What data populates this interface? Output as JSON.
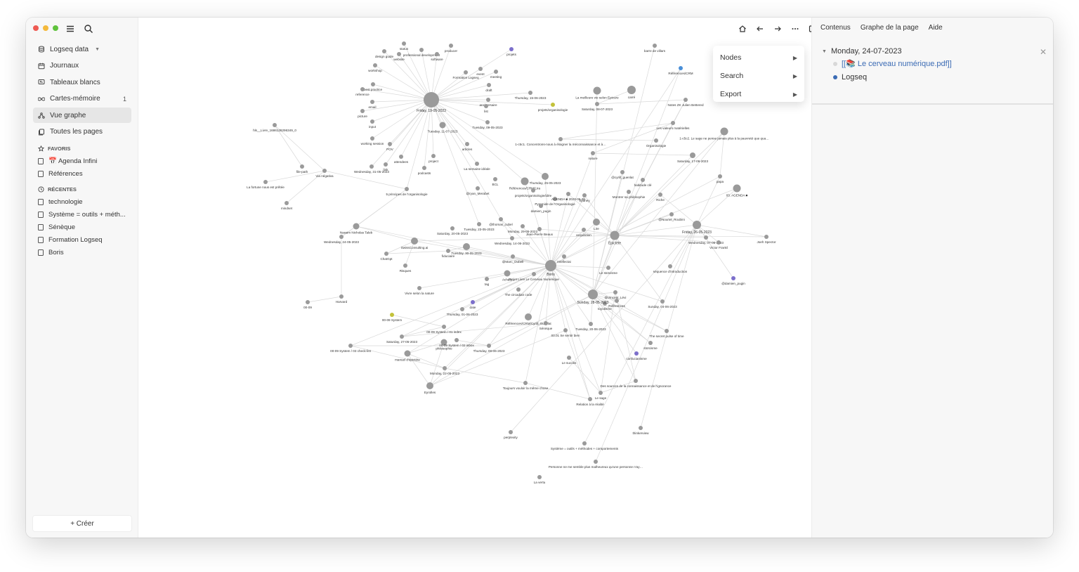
{
  "sidebar": {
    "graph_name": "Logseq data",
    "nav": [
      {
        "label": "Journaux",
        "icon": "calendar-icon"
      },
      {
        "label": "Tableaux blancs",
        "icon": "whiteboard-icon"
      },
      {
        "label": "Cartes-mémoire",
        "icon": "infinity-icon",
        "count": "1"
      },
      {
        "label": "Vue graphe",
        "icon": "graph-icon",
        "active": true
      },
      {
        "label": "Toutes les pages",
        "icon": "pages-icon"
      }
    ],
    "favorites_label": "FAVORIS",
    "favorites": [
      "📅 Agenda Infini",
      "Références"
    ],
    "recents_label": "RÉCENTES",
    "recents": [
      "technologie",
      "Système = outils + méth...",
      "Sénèque",
      "Formation Logseq",
      "Boris"
    ],
    "create_label": "+ Créer"
  },
  "context_menu": {
    "items": [
      {
        "label": "Nodes"
      },
      {
        "label": "Search"
      },
      {
        "label": "Export"
      }
    ]
  },
  "right_panel": {
    "tabs": [
      "Contenus",
      "Graphe de la page",
      "Aide"
    ],
    "page_title": "Monday, 24-07-2023",
    "blocks": [
      "[[📚 Le cerveau numérique.pdf]]",
      "Logseq"
    ]
  },
  "colors": {
    "node": "#9a9a9a",
    "edge": "#d9d9d9",
    "accent_purple": "#7c6fcb",
    "accent_yellow": "#c3c23a",
    "accent_blue": "#4a8fd8"
  },
  "graph": {
    "hubs": [
      {
        "label": "Friday, 19-05-2023"
      },
      {
        "label": "Boris"
      },
      {
        "label": "Sunday, 28-05-2023"
      },
      {
        "label": "Épictète"
      },
      {
        "label": "Friday, 26-05-2023"
      }
    ],
    "labels": [
      "status",
      "professional development",
      "design guide",
      "website",
      "software",
      "producer",
      "projets",
      "workshop",
      "Formation Logseq",
      "event",
      "meeting",
      "best practice",
      "reference",
      "draft",
      "email",
      "anniversaire",
      "list",
      "Thursday, 15-06-2023",
      "projets/organisologie",
      "picture",
      "input",
      "Tuesday, 11-07-2023",
      "Tuesday, 09-05-2023",
      "working session",
      "POV",
      "articles",
      "attendees",
      "project",
      "link",
      "Wednesday, 31-05-2023",
      "podcasts",
      "La semaine idéale",
      "hls__Livre_1686128296349_0",
      "file-path",
      "Via négativa",
      "La fortune nous est prêtée",
      "mindset",
      "5 principes de l'organisologie",
      "BCL",
      "@ryan_Merabet",
      "Références/CRM/Lira",
      "Thursday, 25-05-2023",
      "projets/organisologie/idée",
      "Pyramide de l'Organisologie",
      "AGENDA ■ 2023-06-20",
      "Sydney",
      "damien_pugin",
      "Nassim Nicholas Taleb",
      "Wednesday, 24-05-2023",
      "@thomas_cubel",
      "Monday, 29-05-2023",
      "Saturday, 20-05-2023",
      "Tuesday, 23-05-2023",
      "Jean-Pierre Beaux",
      "acquisition",
      "Lire",
      "SwissConsulting.ai",
      "Wednesday, 14-06-2023",
      "ChatGpt",
      "Tuesday, 30-05-2023",
      "fiduciaire",
      "@Marc_Dubell",
      "Risques",
      "Intellectai",
      "Projet Livre Le Cerveau Numérique",
      "tag",
      "Achats",
      "Vivre selon la nature",
      "The circadian code",
      "Références/CRM/Cyrill_Guenlat",
      "date",
      "Harvard",
      "00-09",
      "Thursday, 01-06-2023",
      "00-09 System",
      "00-09 System / 01 index",
      "Saturday, 27-05-2023",
      "Sénèque",
      "philosophie",
      "00-09 System / 02 inbox",
      "Thursday, 08-06-2023",
      "00-09 System / 03 check-list",
      "manuel d'épictète",
      "Monday, 22-05-2023",
      "Eyrolles",
      "03.01 Se sentir bien",
      "Toujours vouloir la même chose",
      "Relation à la réalité",
      "Le succès",
      "Le sage",
      "Des sources de la connaissance et de l'ignorance",
      "@Vincent_Lévi",
      "Références",
      "Le stoïcisme",
      "Sunday, 04-06-2023",
      "Tuesday, 20-06-2023",
      "The secret pulse of time",
      "stoïcisme",
      "confucianisme",
      "toyotisme",
      "barre de villars",
      "Références/CRM",
      "La meilleure vie selon Epicure",
      "carré",
      "Saturday, 08-07-2023",
      "Notes ZK Julien Bettered",
      "Les valeurs matérielles",
      "1-c5c1. Concentrons-nous à éloigner la méconnaissance et à nous concentrer sur l'utile.",
      "nature",
      "Organisologie",
      "Saturday, 17-06-2023",
      "1-c5c2. Le sage ne pense jamais plus à la pauvreté que quand il nage dans la richesse.",
      "papa",
      "@cyrill_guenlat",
      "habitude clé",
      "Montrer sa philosophie",
      "Riche",
      "03. AGENDA ■",
      "@Nouriel_Roubini",
      "Wednesday, 07-06-2023",
      "Victor Frankl",
      "Joeh Spector",
      "séquence d'introduction",
      "@damien_pugin",
      "perplexity",
      "thinkerview",
      "Système = outils + méthodes + comportements",
      "Personne ne me semble plus malheureux qu'une personne n'ayant jamais été confrontée à l'adversité",
      "La vertu",
      "technologie",
      "hls__230720CERVEAU_NUMERIQUE_2-annoté_1690188149900_0"
    ]
  }
}
